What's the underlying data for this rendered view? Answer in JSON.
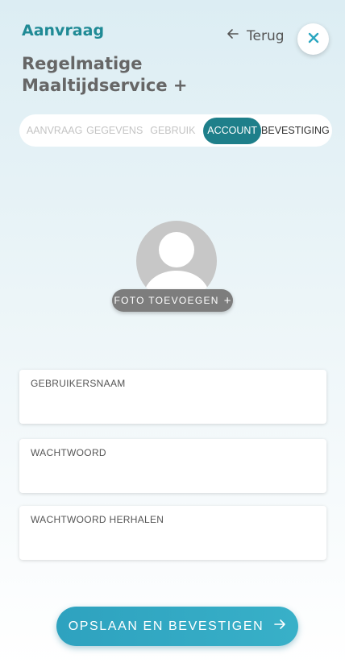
{
  "header": {
    "kicker": "Aanvraag",
    "back_label": "Terug",
    "title_line1": "Regelmatige",
    "title_line2": "Maaltijdservice +"
  },
  "stepper": {
    "steps": [
      {
        "label": "AANVRAAG",
        "state": "done"
      },
      {
        "label": "GEGEVENS",
        "state": "done"
      },
      {
        "label": "GEBRUIK",
        "state": "done"
      },
      {
        "label": "ACCOUNT",
        "state": "active"
      },
      {
        "label": "BEVESTIGING",
        "state": "upcoming"
      }
    ]
  },
  "profile": {
    "add_photo_label": "FOTO TOEVOEGEN",
    "add_photo_icon": "+"
  },
  "form": {
    "username_label": "GEBRUIKERSNAAM",
    "username_value": "",
    "password_label": "WACHTWOORD",
    "password_value": "",
    "password_repeat_label": "WACHTWOORD HERHALEN",
    "password_repeat_value": ""
  },
  "actions": {
    "submit_label": "OPSLAAN EN BEVESTIGEN"
  },
  "colors": {
    "brand": "#1f8a95",
    "active_step": "#1e7f8a",
    "button": "#2ea2bf",
    "close_icon": "#2aa6c0"
  },
  "icons": {
    "back": "arrow-left-icon",
    "close": "close-icon",
    "avatar": "user-silhouette-icon",
    "submit": "arrow-right-icon"
  }
}
